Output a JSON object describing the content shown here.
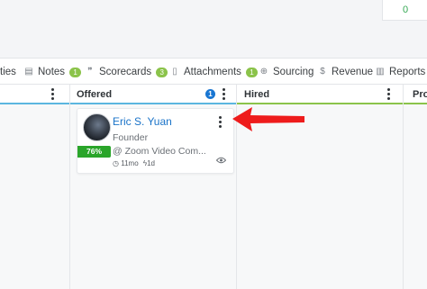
{
  "top_badge": "0",
  "tabs": [
    {
      "label": "ties",
      "icon": "activities-icon",
      "count": null
    },
    {
      "label": "Notes",
      "icon": "notes-icon",
      "count": "1"
    },
    {
      "label": "Scorecards",
      "icon": "scorecards-icon",
      "count": "3"
    },
    {
      "label": "Attachments",
      "icon": "attachments-icon",
      "count": "1"
    },
    {
      "label": "Sourcing",
      "icon": "sourcing-icon",
      "count": null
    },
    {
      "label": "Revenue",
      "icon": "revenue-icon",
      "count": null
    },
    {
      "label": "Reports",
      "icon": "reports-icon",
      "count": null
    }
  ],
  "columns": [
    {
      "title": "",
      "count": null
    },
    {
      "title": "Offered",
      "count": "1"
    },
    {
      "title": "Hired",
      "count": null
    },
    {
      "title": "Pro",
      "count": null
    }
  ],
  "card": {
    "name": "Eric S. Yuan",
    "role": "Founder",
    "company": "@ Zoom Video Com...",
    "score": "76%",
    "age": "11mo",
    "stage_time": "1d"
  },
  "colors": {
    "accent_blue": "#1976d2",
    "score_green": "#2aa52a",
    "count_green": "#8bc34a",
    "annotation_red": "#ee1c1c"
  }
}
